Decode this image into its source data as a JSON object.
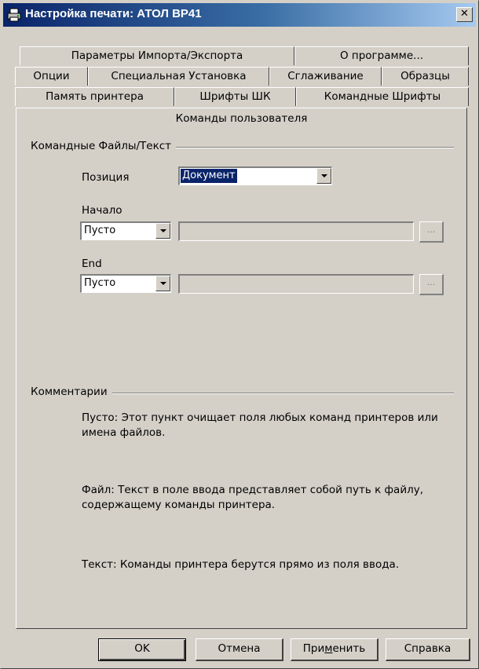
{
  "window": {
    "title": "Настройка печати: АТОЛ ВР41",
    "close_glyph": "✕"
  },
  "tabs": {
    "row1": [
      "Параметры Импорта/Экспорта",
      "О программе..."
    ],
    "row2": [
      "Опции",
      "Специальная Установка",
      "Сглаживание",
      "Образцы"
    ],
    "row3": [
      "Память принтера",
      "Шрифты ШК",
      "Командные Шрифты"
    ],
    "active": "Команды пользователя"
  },
  "command_files": {
    "group_label": "Командные Файлы/Текст",
    "position_label": "Позиция",
    "position_value": "Документ",
    "start_label": "Начало",
    "start_value": "Пусто",
    "end_label": "End",
    "end_value": "Пусто",
    "browse_label": "..."
  },
  "comments": {
    "group_label": "Комментарии",
    "empty_text": "Пусто: Этот пункт очищает поля любых команд принтеров или имена файлов.",
    "file_text": "Файл: Текст в поле ввода представляет собой путь к файлу, содержащему команды принтера.",
    "text_text": "Текст: Команды принтера берутся прямо из поля ввода."
  },
  "buttons": {
    "ok": "OK",
    "cancel": "Отмена",
    "apply_pre": "При",
    "apply_u": "м",
    "apply_post": "енить",
    "help": "Справка"
  },
  "icons": {
    "title_icon": "printer-icon",
    "close_icon": "close-icon",
    "dropdown_icon": "chevron-down-icon"
  }
}
